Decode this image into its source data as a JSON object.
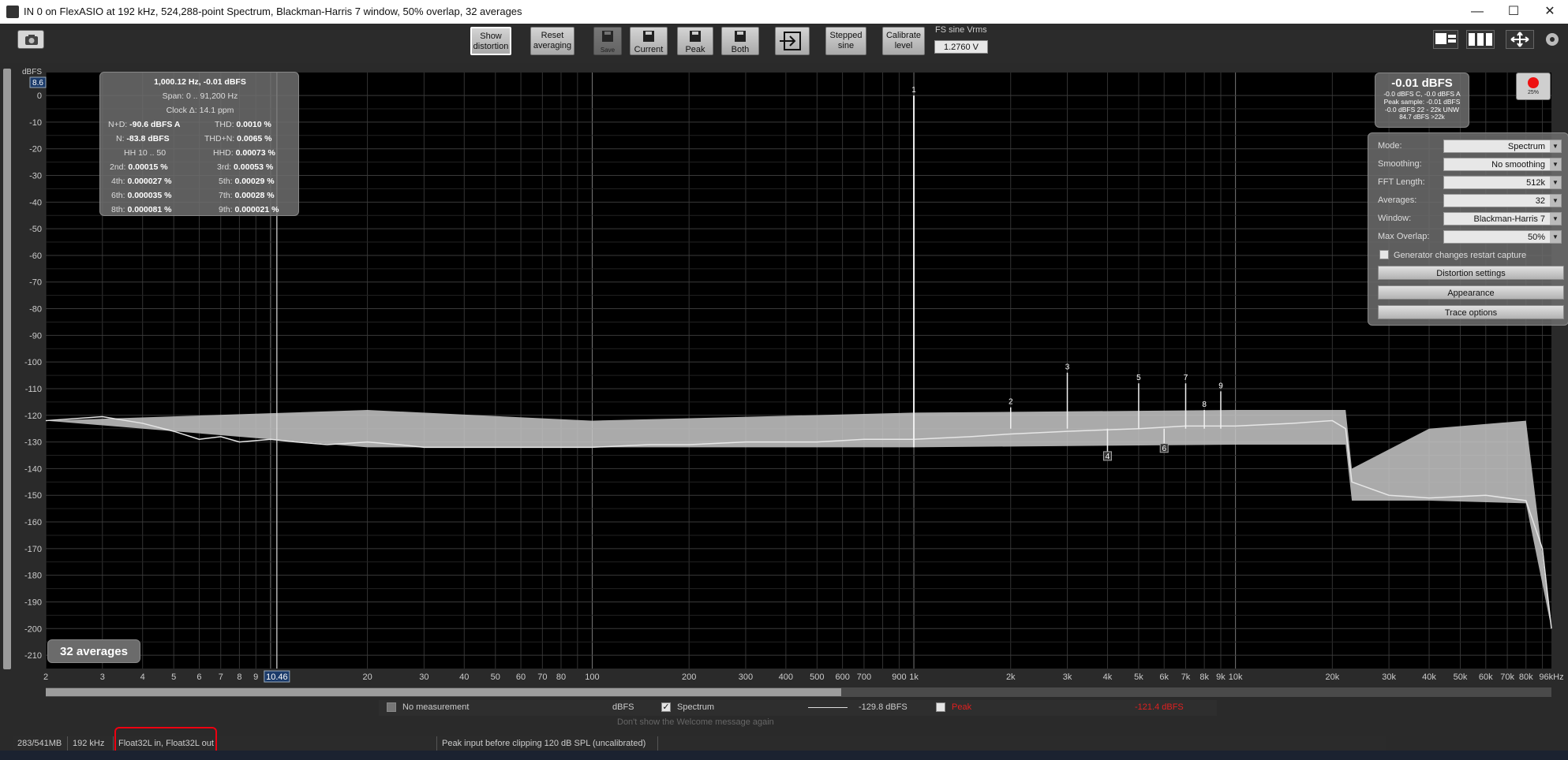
{
  "window": {
    "title": "IN 0 on FlexASIO at 192 kHz, 524,288-point Spectrum, Blackman-Harris 7 window, 50% overlap, 32 averages",
    "controls": {
      "minimize": "—",
      "maximize": "☐",
      "close": "✕"
    }
  },
  "toolbar": {
    "show_distortion": [
      "Show",
      "distortion"
    ],
    "reset_averaging": [
      "Reset",
      "averaging"
    ],
    "save_disabled": "Save",
    "current": "Current",
    "peak": "Peak",
    "both": "Both",
    "stepped_sine": [
      "Stepped",
      "sine"
    ],
    "calibrate_level": [
      "Calibrate",
      "level"
    ],
    "fs_label": "FS sine Vrms",
    "fs_value": "1.2760 V"
  },
  "axis": {
    "y_unit": "dBFS",
    "y_top_value": "8.6",
    "x_cursor_value": "10.46"
  },
  "stats": {
    "header": "1,000.12 Hz, -0.01 dBFS",
    "span": "Span: 0 .. 91,200 Hz",
    "clock": "Clock Δ: 14.1 ppm",
    "nd_label": "N+D:",
    "nd_value": "-90.6 dBFS A",
    "thd_label": "THD:",
    "thd_value": "0.0010 %",
    "n_label": "N:",
    "n_value": "-83.8 dBFS",
    "thdn_label": "THD+N:",
    "thdn_value": "0.0065 %",
    "hh_label": "HH 10 .. 50",
    "hhd_label": "HHD:",
    "hhd_value": "0.00073 %",
    "h2_label": "2nd:",
    "h2_value": "0.00015 %",
    "h3_label": "3rd:",
    "h3_value": "0.00053 %",
    "h4_label": "4th:",
    "h4_value": "0.000027 %",
    "h5_label": "5th:",
    "h5_value": "0.00029 %",
    "h6_label": "6th:",
    "h6_value": "0.000035 %",
    "h7_label": "7th:",
    "h7_value": "0.00028 %",
    "h8_label": "8th:",
    "h8_value": "0.000081 %",
    "h9_label": "9th:",
    "h9_value": "0.000021 %"
  },
  "level": {
    "main": "-0.01 dBFS",
    "line1": "-0.0 dBFS C, -0.0 dBFS A",
    "line2": "Peak sample: -0.01 dBFS",
    "line3": "-0.0 dBFS 22 - 22k UNW",
    "line4": "84.7 dBFS >22k"
  },
  "clip_indicator": {
    "percent": "25%"
  },
  "settings": {
    "mode_label": "Mode:",
    "mode_value": "Spectrum",
    "smoothing_label": "Smoothing:",
    "smoothing_value": "No  smoothing",
    "fft_label": "FFT Length:",
    "fft_value": "512k",
    "averages_label": "Averages:",
    "averages_value": "32",
    "window_label": "Window:",
    "window_value": "Blackman-Harris 7",
    "overlap_label": "Max Overlap:",
    "overlap_value": "50%",
    "generator_restart": "Generator changes restart capture",
    "distortion_settings": "Distortion settings",
    "appearance": "Appearance",
    "trace_options": "Trace options"
  },
  "averages_badge": "32 averages",
  "legend": {
    "no_measurement": "No measurement",
    "dbfs": "dBFS",
    "spectrum": "Spectrum",
    "spectrum_value": "-129.8 dBFS",
    "peak": "Peak",
    "peak_value": "-121.4 dBFS",
    "peak_color": "#e02020",
    "hidden_message": "Don't show the Welcome message again"
  },
  "status": {
    "memory": "283/541MB",
    "rate": "192 kHz",
    "format": "Float32L in, Float32L out",
    "message": "Peak input before clipping 120 dB SPL (uncalibrated)"
  },
  "chart_data": {
    "type": "line",
    "xscale": "log",
    "xlim": [
      2,
      96000
    ],
    "ylim": [
      -215,
      8.6
    ],
    "ylabel": "dBFS",
    "yticks": [
      0,
      -10,
      -20,
      -30,
      -40,
      -50,
      -60,
      -70,
      -80,
      -90,
      -100,
      -110,
      -120,
      -130,
      -140,
      -150,
      -160,
      -170,
      -180,
      -190,
      -200,
      -210
    ],
    "xticks": [
      {
        "v": 2,
        "t": "2"
      },
      {
        "v": 3,
        "t": "3"
      },
      {
        "v": 4,
        "t": "4"
      },
      {
        "v": 5,
        "t": "5"
      },
      {
        "v": 6,
        "t": "6"
      },
      {
        "v": 7,
        "t": "7"
      },
      {
        "v": 8,
        "t": "8"
      },
      {
        "v": 9,
        "t": "9"
      },
      {
        "v": 20,
        "t": "20"
      },
      {
        "v": 30,
        "t": "30"
      },
      {
        "v": 40,
        "t": "40"
      },
      {
        "v": 50,
        "t": "50"
      },
      {
        "v": 60,
        "t": "60"
      },
      {
        "v": 70,
        "t": "70"
      },
      {
        "v": 80,
        "t": "80"
      },
      {
        "v": 100,
        "t": "100"
      },
      {
        "v": 200,
        "t": "200"
      },
      {
        "v": 300,
        "t": "300"
      },
      {
        "v": 400,
        "t": "400"
      },
      {
        "v": 500,
        "t": "500"
      },
      {
        "v": 600,
        "t": "600"
      },
      {
        "v": 700,
        "t": "700"
      },
      {
        "v": 900,
        "t": "900"
      },
      {
        "v": 1000,
        "t": "1k"
      },
      {
        "v": 2000,
        "t": "2k"
      },
      {
        "v": 3000,
        "t": "3k"
      },
      {
        "v": 4000,
        "t": "4k"
      },
      {
        "v": 5000,
        "t": "5k"
      },
      {
        "v": 6000,
        "t": "6k"
      },
      {
        "v": 7000,
        "t": "7k"
      },
      {
        "v": 8000,
        "t": "8k"
      },
      {
        "v": 9000,
        "t": "9k"
      },
      {
        "v": 10000,
        "t": "10k"
      },
      {
        "v": 20000,
        "t": "20k"
      },
      {
        "v": 30000,
        "t": "30k"
      },
      {
        "v": 40000,
        "t": "40k"
      },
      {
        "v": 50000,
        "t": "50k"
      },
      {
        "v": 60000,
        "t": "60k"
      },
      {
        "v": 70000,
        "t": "70k"
      },
      {
        "v": 80000,
        "t": "80k"
      },
      {
        "v": 96000,
        "t": "96kHz"
      }
    ],
    "series": [
      {
        "x": [
          2,
          3,
          4,
          5,
          6,
          7,
          8,
          10,
          12,
          15,
          20,
          25,
          30,
          40,
          50,
          70,
          100,
          150,
          200,
          300,
          500,
          700,
          1000,
          1500,
          2000,
          3000,
          5000,
          7000,
          10000,
          15000,
          20000,
          22000,
          23000,
          30000,
          40000,
          60000,
          80000,
          90000,
          96000
        ],
        "y": [
          -122,
          -120.5,
          -123,
          -126,
          -129,
          -128,
          -130,
          -129,
          -130,
          -131,
          -130,
          -131,
          -132,
          -132,
          -132,
          -132,
          -132,
          -131,
          -131,
          -130,
          -130,
          -129,
          -129,
          -128,
          -127,
          -126,
          -125,
          -124,
          -124,
          -123,
          -122,
          -125,
          -145,
          -150,
          -151,
          -150,
          -152,
          -170,
          -200
        ]
      }
    ],
    "spectrum_floor": {
      "x": [
        2,
        20,
        100,
        1000,
        10000,
        20000,
        22000,
        23000,
        40000,
        80000,
        96000
      ],
      "top": [
        -122,
        -118,
        -122,
        -119,
        -118,
        -118,
        -118,
        -140,
        -125,
        -122,
        -200
      ],
      "bottom": [
        -122,
        -132,
        -132,
        -132,
        -131,
        -131,
        -131,
        -152,
        -152,
        -153,
        -200
      ]
    },
    "harmonics": [
      {
        "label": "1",
        "x": 1000,
        "y": -0.01
      },
      {
        "label": "2",
        "x": 2000,
        "y": -117
      },
      {
        "label": "3",
        "x": 3000,
        "y": -104
      },
      {
        "label": "4",
        "x": 4000,
        "y": -136
      },
      {
        "label": "5",
        "x": 5000,
        "y": -108
      },
      {
        "label": "6",
        "x": 6000,
        "y": -133
      },
      {
        "label": "7",
        "x": 7000,
        "y": -108
      },
      {
        "label": "8",
        "x": 8000,
        "y": -118
      },
      {
        "label": "9",
        "x": 9000,
        "y": -111
      }
    ],
    "cursor_x": 10.46,
    "grid": true
  }
}
